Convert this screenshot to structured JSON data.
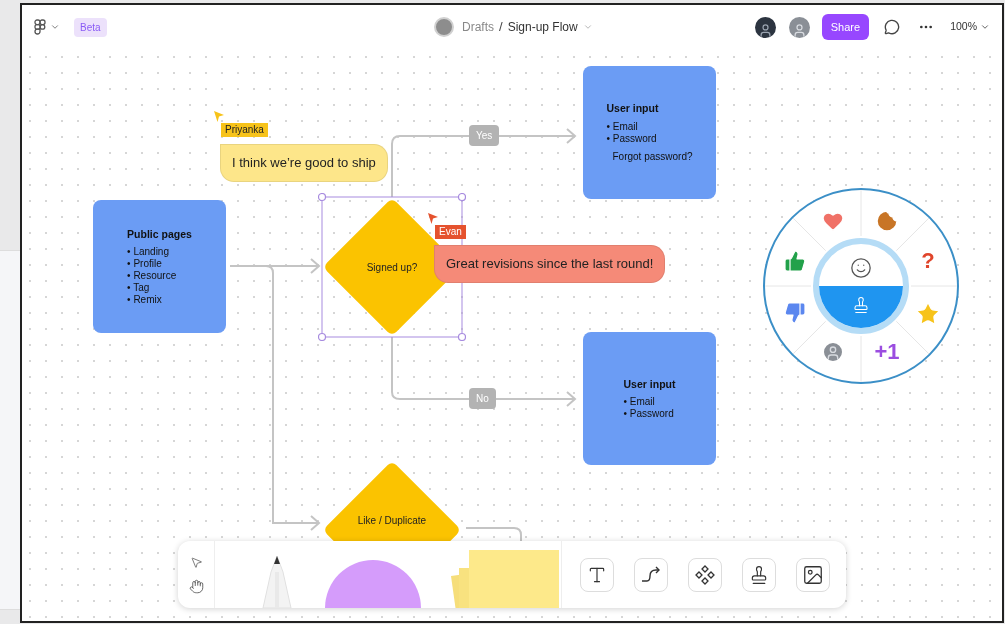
{
  "header": {
    "beta_badge": "Beta",
    "folder": "Drafts",
    "separator": "/",
    "file_name": "Sign-up Flow",
    "share_button": "Share",
    "zoom": "100%"
  },
  "nodes": [
    {
      "kind": "box",
      "title": "User input",
      "items": [
        "• Email",
        "• Password"
      ],
      "note": "Forgot password?"
    },
    {
      "kind": "box",
      "title": "Public pages",
      "items": [
        "• Landing",
        "• Profile",
        "• Resource",
        "• Tag",
        "• Remix"
      ]
    },
    {
      "kind": "diamond",
      "label": "Signed up?",
      "selected": true
    },
    {
      "kind": "box",
      "title": "User input",
      "items": [
        "• Email",
        "• Password"
      ]
    },
    {
      "kind": "diamond",
      "label": "Like / Duplicate",
      "selected": false
    }
  ],
  "edge_labels": [
    "Yes",
    "No"
  ],
  "cursors": [
    {
      "name": "Priyanka",
      "color": "#f7c31a",
      "message": {
        "text": "I think we’re good to ship",
        "color": "#fde68a"
      }
    },
    {
      "name": "Evan",
      "color": "#e5522e",
      "message": {
        "text": "Great revisions since the last round!",
        "color": "#f58a78"
      }
    }
  ],
  "reaction_wheel": {
    "stickers": [
      {
        "kind": "heart"
      },
      {
        "kind": "cookie"
      },
      {
        "kind": "text",
        "text": "?",
        "color": "#e0452b"
      },
      {
        "kind": "star"
      },
      {
        "kind": "text",
        "text": "+1",
        "color": "#9b4de0"
      },
      {
        "kind": "avatar"
      },
      {
        "kind": "thumbs-down"
      },
      {
        "kind": "thumbs-up"
      }
    ]
  }
}
